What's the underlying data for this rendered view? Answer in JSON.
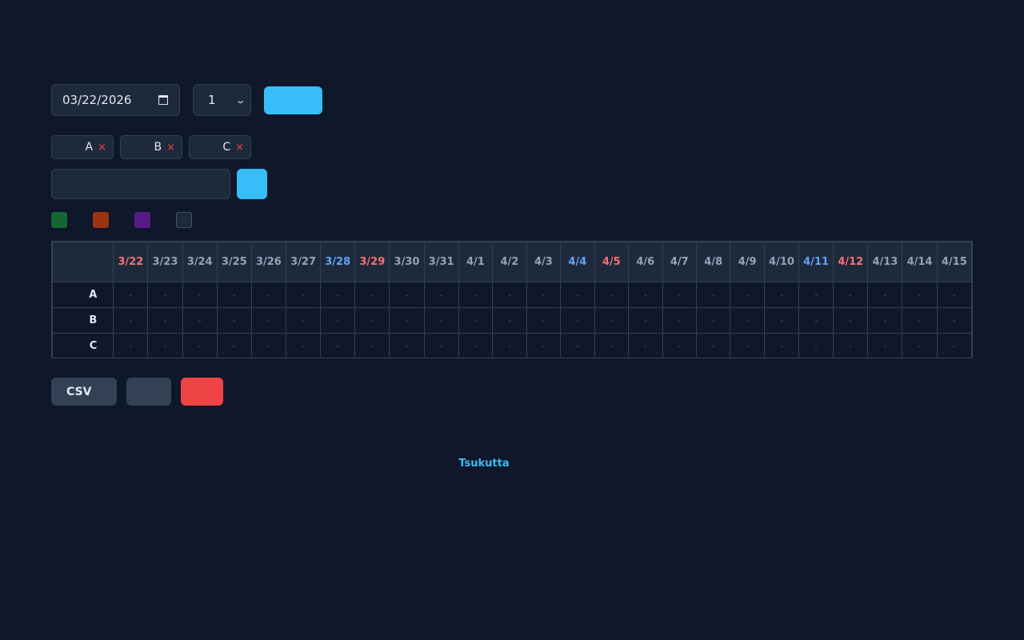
{
  "controls": {
    "date_value": "03/22/2026",
    "count_value": "1"
  },
  "members": [
    {
      "name": "A"
    },
    {
      "name": "B"
    },
    {
      "name": "C"
    }
  ],
  "chip_remove_symbol": "×",
  "swatch_colors": [
    "#166534",
    "#9a3412",
    "#581c87",
    "#1e293b"
  ],
  "schedule": {
    "dates": [
      {
        "label": "3/22",
        "tone": "red"
      },
      {
        "label": "3/23",
        "tone": ""
      },
      {
        "label": "3/24",
        "tone": ""
      },
      {
        "label": "3/25",
        "tone": ""
      },
      {
        "label": "3/26",
        "tone": ""
      },
      {
        "label": "3/27",
        "tone": ""
      },
      {
        "label": "3/28",
        "tone": "blue"
      },
      {
        "label": "3/29",
        "tone": "red"
      },
      {
        "label": "3/30",
        "tone": ""
      },
      {
        "label": "3/31",
        "tone": ""
      },
      {
        "label": "4/1",
        "tone": ""
      },
      {
        "label": "4/2",
        "tone": ""
      },
      {
        "label": "4/3",
        "tone": ""
      },
      {
        "label": "4/4",
        "tone": "blue"
      },
      {
        "label": "4/5",
        "tone": "red"
      },
      {
        "label": "4/6",
        "tone": ""
      },
      {
        "label": "4/7",
        "tone": ""
      },
      {
        "label": "4/8",
        "tone": ""
      },
      {
        "label": "4/9",
        "tone": ""
      },
      {
        "label": "4/10",
        "tone": ""
      },
      {
        "label": "4/11",
        "tone": "blue"
      },
      {
        "label": "4/12",
        "tone": "red"
      },
      {
        "label": "4/13",
        "tone": ""
      },
      {
        "label": "4/14",
        "tone": ""
      },
      {
        "label": "4/15",
        "tone": ""
      }
    ],
    "empty_cell": "-"
  },
  "actions": {
    "csv_label": "CSV"
  },
  "footer": {
    "credit": "Tsukutta"
  }
}
